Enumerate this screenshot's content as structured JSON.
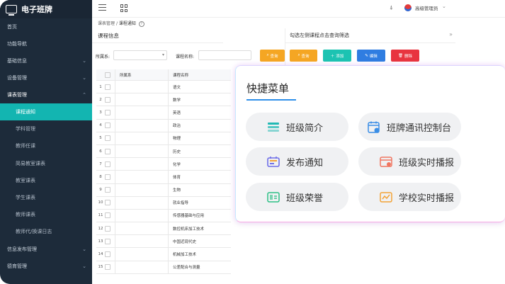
{
  "sidebar": {
    "app_title": "电子班牌",
    "items": [
      {
        "label": "首页",
        "arrow": ""
      },
      {
        "label": "功能导航",
        "arrow": ""
      },
      {
        "label": "基础信息",
        "arrow": "⌄"
      },
      {
        "label": "设备管理",
        "arrow": "⌄"
      },
      {
        "label": "课表管理",
        "arrow": "⌃"
      }
    ],
    "sub_items": [
      "课程通知",
      "学科管理",
      "教师任课",
      "简易教室课表",
      "教室课表",
      "学生课表",
      "教师课表",
      "教师代/换课日志"
    ],
    "bottom_items": [
      {
        "label": "信息发布管理",
        "arrow": "⌄"
      },
      {
        "label": "德育管理",
        "arrow": "⌄"
      }
    ]
  },
  "topbar": {
    "user_label": "高级管理员",
    "bell": "⍋"
  },
  "breadcrumb": {
    "parent": "课表管理",
    "sep": "/",
    "current": "课程通知"
  },
  "course_panel": {
    "title": "课程信息",
    "filter_dept_label": "所属系:",
    "filter_name_label": "课程名称:",
    "query_label": "查询",
    "table_headers": {
      "dept": "所属系",
      "name": "课程名称"
    },
    "rows": [
      {
        "no": "1",
        "name": "语文"
      },
      {
        "no": "2",
        "name": "数学"
      },
      {
        "no": "3",
        "name": "英语"
      },
      {
        "no": "4",
        "name": "政治"
      },
      {
        "no": "5",
        "name": "物理"
      },
      {
        "no": "6",
        "name": "历史"
      },
      {
        "no": "7",
        "name": "化学"
      },
      {
        "no": "8",
        "name": "体育"
      },
      {
        "no": "9",
        "name": "生物"
      },
      {
        "no": "10",
        "name": "就业指导"
      },
      {
        "no": "11",
        "name": "传感器基础与应用"
      },
      {
        "no": "12",
        "name": "数控机床加工技术"
      },
      {
        "no": "13",
        "name": "中国近现代史"
      },
      {
        "no": "14",
        "name": "机械加工技术"
      },
      {
        "no": "15",
        "name": "公差配合与测量"
      }
    ]
  },
  "notice_panel": {
    "hint": "勾选左侧课程点击查询筛选",
    "buttons": {
      "query": "查询",
      "add": "添加",
      "edit": "编辑",
      "delete": "删除"
    }
  },
  "quick_menu": {
    "title": "快捷菜单",
    "items": [
      {
        "label": "班级简介",
        "icon": "list-icon",
        "color": "#21b9b4"
      },
      {
        "label": "班牌通讯控制台",
        "icon": "calendar-icon",
        "color": "#3a8ee6"
      },
      {
        "label": "发布通知",
        "icon": "notice-icon",
        "color": "#6f6fe8"
      },
      {
        "label": "班级实时播报",
        "icon": "broadcast-icon",
        "color": "#f07560"
      },
      {
        "label": "班级荣誉",
        "icon": "honor-icon",
        "color": "#2bbf85"
      },
      {
        "label": "学校实时播报",
        "icon": "school-broadcast-icon",
        "color": "#f3a235"
      }
    ]
  }
}
